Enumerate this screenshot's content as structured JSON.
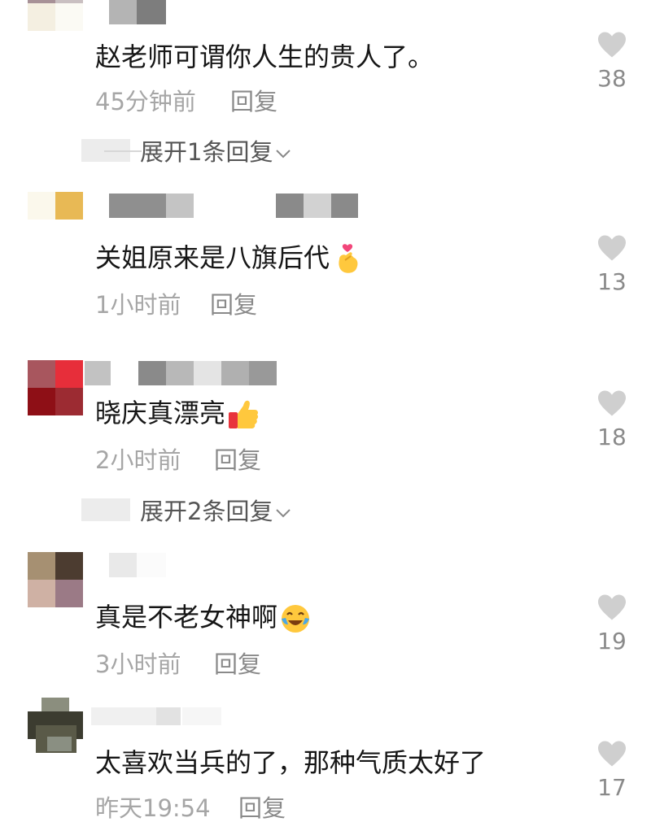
{
  "comments": [
    {
      "text": "赵老师可谓你人生的贵人了。",
      "time": "45分钟前",
      "reply": "回复",
      "likes": "38",
      "expand": "展开1条回复"
    },
    {
      "text": "关姐原来是八旗后代",
      "emoji": "finger-heart-emoji",
      "time": "1小时前",
      "reply": "回复",
      "likes": "13"
    },
    {
      "text": "晓庆真漂亮",
      "emoji": "thumbs-up-emoji",
      "time": "2小时前",
      "reply": "回复",
      "likes": "18",
      "expand": "展开2条回复"
    },
    {
      "text": "真是不老女神啊",
      "emoji": "tears-of-joy-emoji",
      "time": "3小时前",
      "reply": "回复",
      "likes": "19"
    },
    {
      "text": "太喜欢当兵的了，那种气质太好了",
      "time": "昨天19:54",
      "reply": "回复",
      "likes": "17"
    }
  ],
  "icons": {
    "like": "heart-icon",
    "expand": "chevron-down-icon"
  },
  "colors": {
    "text": "#161616",
    "meta": "#a6a6a6",
    "like_icon": "#cfcfcf"
  }
}
